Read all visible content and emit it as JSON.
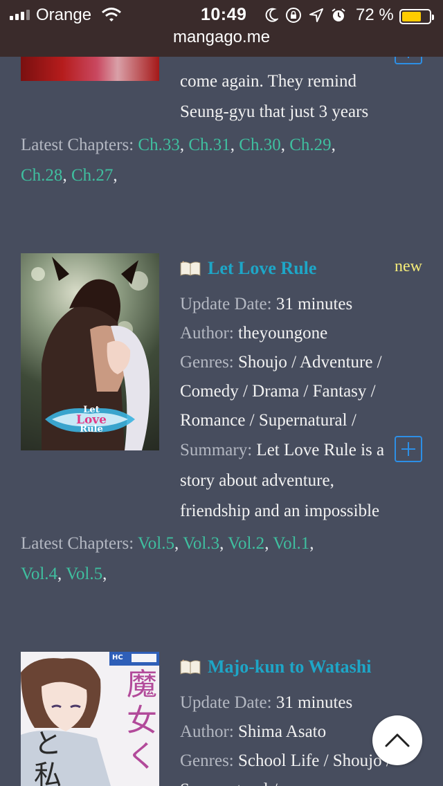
{
  "status_bar": {
    "carrier": "Orange",
    "time": "10:49",
    "battery_percent": "72 %",
    "battery_level": 0.72,
    "icons": [
      "signal-icon",
      "wifi-icon",
      "moon-icon",
      "rotation-lock-icon",
      "location-arrow-icon",
      "alarm-icon",
      "battery-icon"
    ]
  },
  "url_bar": {
    "domain": "mangago.me"
  },
  "colors": {
    "background": "#474d5e",
    "title": "#1ea6c7",
    "chapter_link": "#3fbf9f",
    "new_badge": "#f5ec7a",
    "add_button": "#2d8fe6"
  },
  "entries": [
    {
      "summary_tail": [
        "come again. They remind",
        "Seung-gyu that just 3 years"
      ],
      "latest_label": "Latest Chapters:",
      "chapters": [
        "Ch.33",
        "Ch.31",
        "Ch.30",
        "Ch.29",
        "Ch.28",
        "Ch.27"
      ]
    },
    {
      "title": "Let Love Rule",
      "badge": "new",
      "update_label": "Update Date:",
      "update_value": "31 minutes",
      "author_label": "Author:",
      "author_value": "theyoungone",
      "genres_label": "Genres:",
      "genres_lines": [
        "Shoujo / Adventure /",
        "Comedy / Drama / Fantasy /",
        "Romance / Supernatural /"
      ],
      "summary_label": "Summary:",
      "summary_lines": [
        "Let Love Rule is a",
        "story about adventure,",
        "friendship and an impossible"
      ],
      "cover_text": [
        "Let",
        "Love",
        "Rule"
      ],
      "latest_label": "Latest Chapters:",
      "chapters": [
        "Vol.5",
        "Vol.3",
        "Vol.2",
        "Vol.1",
        "Vol.4",
        "Vol.5"
      ]
    },
    {
      "title": "Majo-kun to Watashi",
      "update_label": "Update Date:",
      "update_value": "31 minutes",
      "author_label": "Author:",
      "author_value": "Shima Asato",
      "genres_label": "Genres:",
      "genres_lines": [
        "School Life / Shoujo /",
        "Supernatural /"
      ],
      "cover_text": [
        "魔",
        "女",
        "く",
        "と",
        "私",
        "HC"
      ]
    }
  ],
  "separator": ","
}
